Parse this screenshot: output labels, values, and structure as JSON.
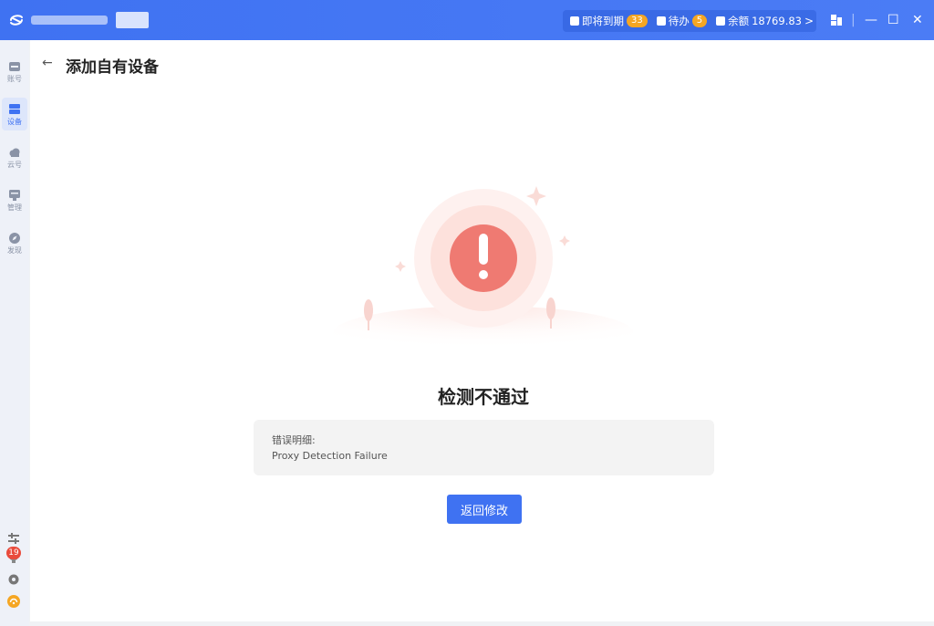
{
  "titlebar": {
    "status": {
      "expiring_label": "即将到期",
      "expiring_count": "33",
      "todo_label": "待办",
      "todo_count": "5",
      "balance_label": "余额",
      "balance_value": "18769.83",
      "chevron": ">"
    },
    "controls": {
      "minimize": "—",
      "maximize": "☐",
      "close": "✕"
    }
  },
  "sidebar": {
    "items": [
      {
        "label": "账号",
        "icon": "account-icon"
      },
      {
        "label": "设备",
        "icon": "device-icon",
        "active": true
      },
      {
        "label": "云号",
        "icon": "cloud-icon"
      },
      {
        "label": "管理",
        "icon": "manage-icon"
      },
      {
        "label": "发现",
        "icon": "discover-icon"
      }
    ],
    "bottom": {
      "notification_count": "19"
    }
  },
  "page": {
    "back_icon": "←",
    "title": "添加自有设备",
    "result_title": "检测不通过",
    "error_label": "错误明细:",
    "error_value": "Proxy Detection Failure",
    "return_button": "返回修改"
  },
  "colors": {
    "accent": "#3f72f2",
    "badge": "#f5a623",
    "error": "#ef7a72"
  }
}
